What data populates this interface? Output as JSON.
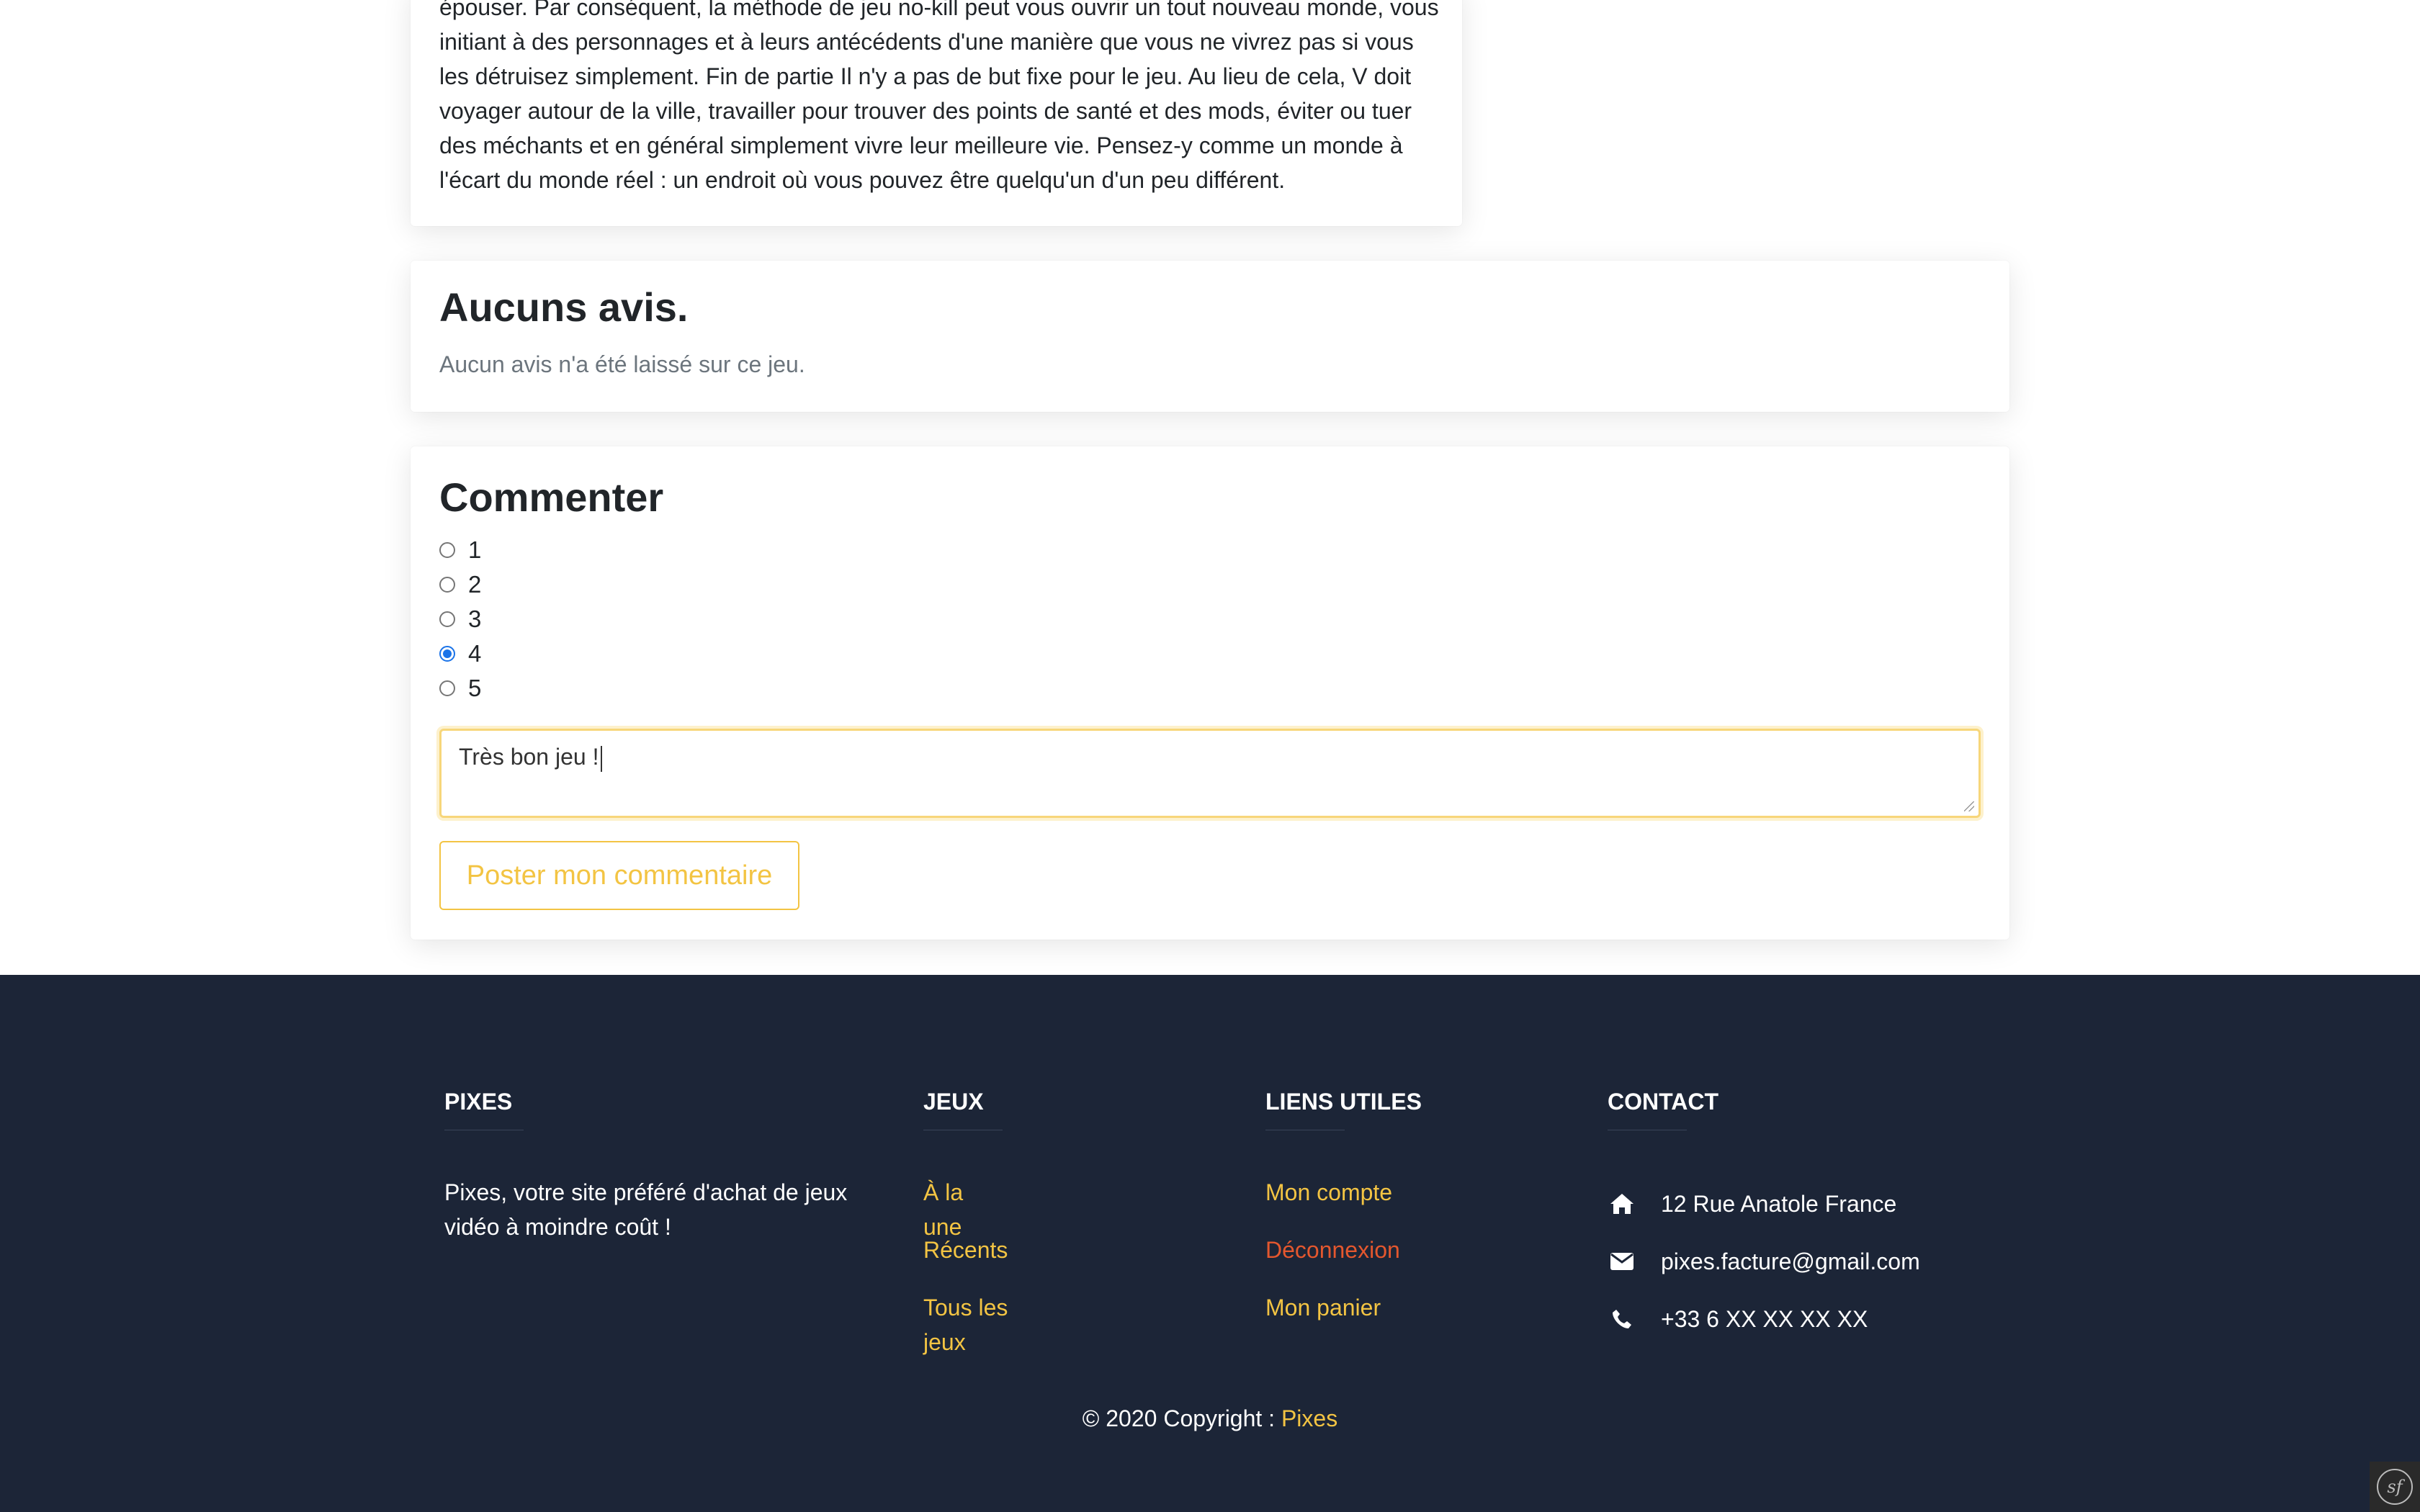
{
  "description": {
    "text": "épouser. Par conséquent, la méthode de jeu no-kill peut vous ouvrir un tout nouveau monde, vous initiant à des personnages et à leurs antécédents d'une manière que vous ne vivrez pas si vous les détruisez simplement. Fin de partie Il n'y a pas de but fixe pour le jeu. Au lieu de cela, V doit voyager autour de la ville, travailler pour trouver des points de santé et des mods, éviter ou tuer des méchants et en général simplement vivre leur meilleure vie. Pensez-y comme un monde à l'écart du monde réel : un endroit où vous pouvez être quelqu'un d'un peu différent."
  },
  "reviews": {
    "title": "Aucuns avis.",
    "subtitle": "Aucun avis n'a été laissé sur ce jeu."
  },
  "comment": {
    "title": "Commenter",
    "ratings": [
      {
        "label": "1",
        "checked": false
      },
      {
        "label": "2",
        "checked": false
      },
      {
        "label": "3",
        "checked": false
      },
      {
        "label": "4",
        "checked": true
      },
      {
        "label": "5",
        "checked": false
      }
    ],
    "text_value": "Très bon jeu !",
    "submit_label": "Poster mon commentaire"
  },
  "footer": {
    "brand": {
      "heading": "PIXES",
      "text": "Pixes, votre site préféré d'achat de jeux vidéo à moindre coût !"
    },
    "games": {
      "heading": "JEUX",
      "links": [
        "À la une",
        "Récents",
        "Tous les jeux"
      ]
    },
    "useful": {
      "heading": "LIENS UTILES",
      "links": [
        "Mon compte",
        "Déconnexion",
        "Mon panier"
      ]
    },
    "contact": {
      "heading": "CONTACT",
      "address": "12 Rue Anatole France",
      "email": "pixes.facture@gmail.com",
      "phone": "+33 6 XX XX XX XX",
      "icons": [
        "home-icon",
        "envelope-icon",
        "phone-icon"
      ]
    },
    "copyright_prefix": "© 2020 Copyright : ",
    "copyright_link": "Pixes"
  },
  "colors": {
    "accent": "#f3c443",
    "danger": "#e4572e",
    "footer_bg": "#1c2537",
    "radio_checked": "#1a73e8"
  }
}
